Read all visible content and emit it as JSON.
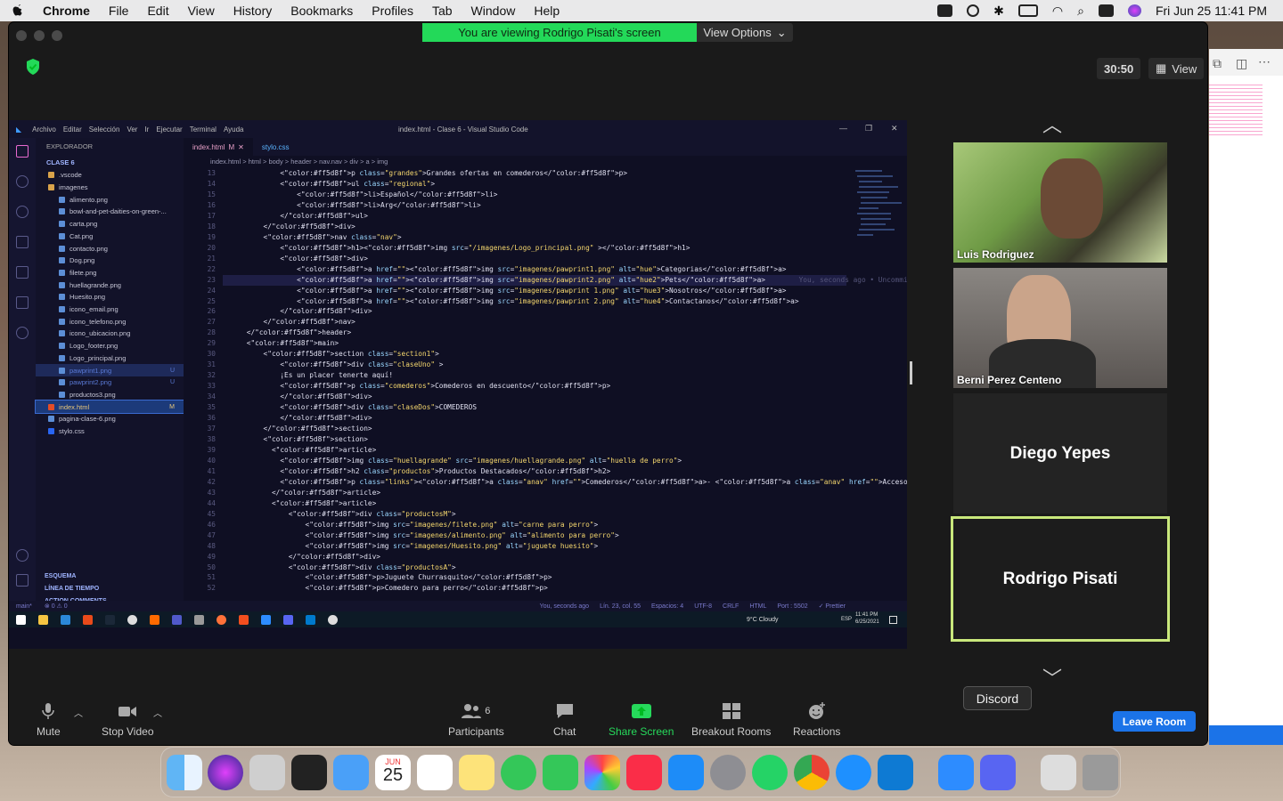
{
  "menubar": {
    "app": "Chrome",
    "items": [
      "File",
      "Edit",
      "View",
      "History",
      "Bookmarks",
      "Profiles",
      "Tab",
      "Window",
      "Help"
    ],
    "clock": "Fri Jun 25  11:41 PM"
  },
  "zoom": {
    "banner_text": "You are viewing Rodrigo Pisati's screen",
    "view_options": "View Options",
    "timer": "30:50",
    "view_label": "View",
    "participants": [
      {
        "name": "Luis Rodriguez",
        "video": true
      },
      {
        "name": "Berni Perez Centeno",
        "video": true
      },
      {
        "name": "Diego Yepes",
        "video": false
      },
      {
        "name": "Rodrigo Pisati",
        "video": false,
        "active": true
      }
    ],
    "toolbar": {
      "mute": "Mute",
      "stop_video": "Stop Video",
      "participants": "Participants",
      "participants_count": "6",
      "chat": "Chat",
      "share_screen": "Share Screen",
      "breakout": "Breakout Rooms",
      "reactions": "Reactions",
      "leave": "Leave Room",
      "tooltip": "Discord"
    }
  },
  "vscode": {
    "menu": [
      "Archivo",
      "Editar",
      "Selección",
      "Ver",
      "Ir",
      "Ejecutar",
      "Terminal",
      "Ayuda"
    ],
    "title": "index.html - Clase 6 - Visual Studio Code",
    "explorer_title": "EXPLORADOR",
    "folder": "CLASE 6",
    "files": [
      {
        "name": ".vscode",
        "indent": 1,
        "folder": true
      },
      {
        "name": "imagenes",
        "indent": 1,
        "folder": true,
        "open": true
      },
      {
        "name": "alimento.png",
        "indent": 2
      },
      {
        "name": "bowl-and-pet-daities-on-green-...",
        "indent": 2
      },
      {
        "name": "carta.png",
        "indent": 2
      },
      {
        "name": "Cat.png",
        "indent": 2
      },
      {
        "name": "contacto.png",
        "indent": 2
      },
      {
        "name": "Dog.png",
        "indent": 2
      },
      {
        "name": "filete.png",
        "indent": 2
      },
      {
        "name": "huellagrande.png",
        "indent": 2
      },
      {
        "name": "Huesito.png",
        "indent": 2
      },
      {
        "name": "icono_email.png",
        "indent": 2
      },
      {
        "name": "icono_telefono.png",
        "indent": 2
      },
      {
        "name": "icono_ubicacion.png",
        "indent": 2
      },
      {
        "name": "Logo_footer.png",
        "indent": 2
      },
      {
        "name": "Logo_principal.png",
        "indent": 2
      },
      {
        "name": "pawprint1.png",
        "indent": 2,
        "badge": "U"
      },
      {
        "name": "pawprint2.png",
        "indent": 2,
        "badge": "U"
      },
      {
        "name": "productos3.png",
        "indent": 2
      },
      {
        "name": "index.html",
        "indent": 1,
        "badge": "M",
        "selected": true
      },
      {
        "name": "pagina-clase-6.png",
        "indent": 1
      },
      {
        "name": "stylo.css",
        "indent": 1
      }
    ],
    "sections": [
      "ESQUEMA",
      "LÍNEA DE TIEMPO",
      "ACTION COMMENTS"
    ],
    "tabs": [
      {
        "label": "index.html",
        "mark": "M",
        "active": true
      },
      {
        "label": "stylo.css"
      }
    ],
    "breadcrumb": "index.html > html > body > header > nav.nav > div > a > img",
    "code": [
      {
        "n": "13",
        "t": "            <p class=\"grandes\">Grandes ofertas en comederos</p>"
      },
      {
        "n": "14",
        "t": "            <ul class=\"regional\">"
      },
      {
        "n": "15",
        "t": "                <li>Español</li>"
      },
      {
        "n": "16",
        "t": "                <li>Arg</li>"
      },
      {
        "n": "17",
        "t": "            </ul>"
      },
      {
        "n": "18",
        "t": "        </div>"
      },
      {
        "n": "19",
        "t": "        <nav class=\"nav\">"
      },
      {
        "n": "20",
        "t": "            <h1><img src=\"/imagenes/Logo_principal.png\" ></h1>"
      },
      {
        "n": "21",
        "t": "            <div>"
      },
      {
        "n": "22",
        "t": "                <a href=\"\"><img src=\"imagenes/pawprint1.png\" alt=\"hue\">Categorias</a>"
      },
      {
        "n": "23",
        "t": "                <a href=\"\"><img src=\"imagenes/pawprint2.png\" alt=\"hue2\">Pets</a>        You, seconds ago • Uncommitted changes"
      },
      {
        "n": "24",
        "t": "                <a href=\"\"><img src=\"imagenes/pawprint 1.png\" alt=\"hue3\">Nosotros</a>"
      },
      {
        "n": "25",
        "t": "                <a href=\"\"><img src=\"imagenes/pawprint 2.png\" alt=\"hue4\">Contactanos</a>"
      },
      {
        "n": "26",
        "t": "            </div>"
      },
      {
        "n": "27",
        "t": "        </nav>"
      },
      {
        "n": "28",
        "t": "    </header>"
      },
      {
        "n": "29",
        "t": "    <main>"
      },
      {
        "n": "30",
        "t": "        <section class=\"section1\">"
      },
      {
        "n": "31",
        "t": "            <div class=\"claseUno\" >"
      },
      {
        "n": "32",
        "t": "            ¡Es un placer tenerte aquí!"
      },
      {
        "n": "33",
        "t": "            <p class=\"comederos\">Comederos en descuento</p>"
      },
      {
        "n": "34",
        "t": "            </div>"
      },
      {
        "n": "35",
        "t": "            <div class=\"claseDos\">COMEDEROS"
      },
      {
        "n": "36",
        "t": "            </div>"
      },
      {
        "n": "37",
        "t": "        </section>"
      },
      {
        "n": "38",
        "t": "        <section>"
      },
      {
        "n": "39",
        "t": "          <article>"
      },
      {
        "n": "40",
        "t": "            <img class=\"huellagrande\" src=\"imagenes/huellagrande.png\" alt=\"huella de perro\">"
      },
      {
        "n": "41",
        "t": "            <h2 class=\"productos\">Productos Destacados</h2>"
      },
      {
        "n": "42",
        "t": "            <p class=\"links\"><a class=\"anav\" href=\"\">Comederos</a>- <a class=\"anav\" href=\"\">Accesorios</a>- <a class=\"anav\" href=\"\">Comida</a></"
      },
      {
        "n": "43",
        "t": "          </article>"
      },
      {
        "n": "44",
        "t": "          <article>"
      },
      {
        "n": "45",
        "t": "              <div class=\"productosM\">"
      },
      {
        "n": "46",
        "t": "                  <img src=\"imagenes/filete.png\" alt=\"carne para perro\">"
      },
      {
        "n": "47",
        "t": "                  <img src=\"imagenes/alimento.png\" alt=\"alimento para perro\">"
      },
      {
        "n": "48",
        "t": "                  <img src=\"imagenes/Huesito.png\" alt=\"juguete huesito\">"
      },
      {
        "n": "49",
        "t": "              </div>"
      },
      {
        "n": "50",
        "t": "              <div class=\"productosA\">"
      },
      {
        "n": "51",
        "t": "                  <p>Juguete Churrasquito</p>"
      },
      {
        "n": "52",
        "t": "                  <p>Comedero para perro</p>"
      }
    ],
    "status": {
      "branch": "main*",
      "problems": "⊗ 0 ⚠ 0",
      "blame": "You, seconds ago",
      "position": "Lín. 23, col. 55",
      "spaces": "Espacios: 4",
      "encoding": "UTF-8",
      "eol": "CRLF",
      "lang": "HTML",
      "port": "Port : 5502",
      "prettier": "✓ Prettier"
    },
    "taskbar": {
      "weather": "9°C  Cloudy",
      "lang": "ESP",
      "time": "11:41 PM",
      "date": "6/25/2021"
    }
  },
  "dock": {
    "calendar_month": "JUN",
    "calendar_day": "25"
  }
}
